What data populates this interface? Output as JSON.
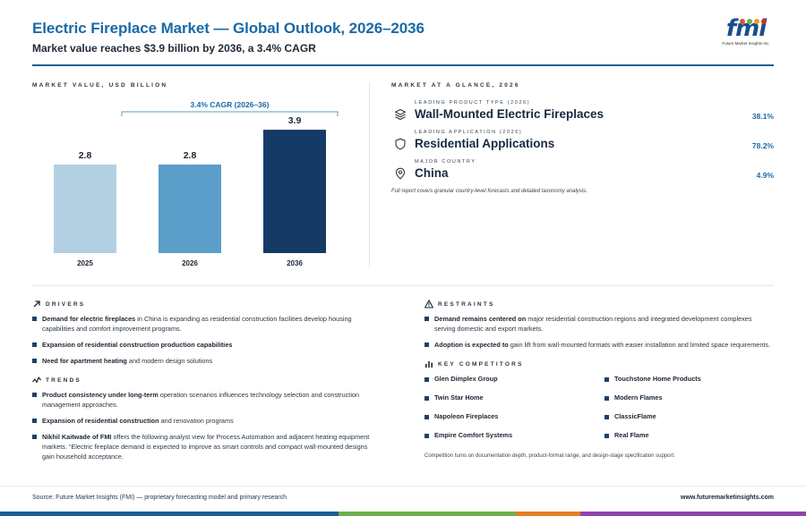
{
  "header": {
    "title": "Electric Fireplace Market — Global Outlook, 2026–2036",
    "subtitle": "Market value reaches $3.9 billion by 2036, a 3.4% CAGR"
  },
  "logo": {
    "text": "fmi",
    "tagline": "Future Market Insights Inc.",
    "dot_colors": [
      "#e84d3d",
      "#6ab04c",
      "#f39c12",
      "#c0392b"
    ]
  },
  "chart": {
    "section_label": "MARKET VALUE, USD BILLION",
    "cagr_label": "3.4% CAGR (2026–36)"
  },
  "chart_data": {
    "type": "bar",
    "categories": [
      "2025",
      "2026",
      "2036"
    ],
    "values": [
      2.8,
      2.8,
      3.9
    ],
    "value_labels": [
      "2.8",
      "2.8",
      "3.9"
    ],
    "colors": [
      "#b3d0e3",
      "#5b9ec9",
      "#163a66"
    ],
    "ylim": [
      0,
      4.1
    ],
    "annotation": "3.4% CAGR (2026–36)",
    "grid": false
  },
  "glance": {
    "section_label": "MARKET AT A GLANCE, 2026",
    "items": [
      {
        "label": "LEADING PRODUCT TYPE (2026)",
        "value": "Wall-Mounted Electric Fireplaces",
        "share": "38.1%",
        "icon": "layers-icon"
      },
      {
        "label": "LEADING APPLICATION (2026)",
        "value": "Residential Applications",
        "share": "78.2%",
        "icon": "shield-icon"
      },
      {
        "label": "MAJOR COUNTRY",
        "value": "China",
        "share": "4.9%",
        "icon": "location-pin-icon"
      }
    ],
    "note": "Full report covers granular country-level forecasts and detailed taxonomy analysis."
  },
  "drivers": {
    "label": "DRIVERS",
    "items": [
      {
        "bold": "Demand for electric fireplaces",
        "rest": " in China is expanding as residential construction facilities develop housing capabilities and comfort improvement programs."
      },
      {
        "bold": "Expansion of residential construction production capabilities",
        "rest": ""
      },
      {
        "bold": "Need for apartment heating",
        "rest": " and modern design solutions"
      }
    ]
  },
  "trends": {
    "label": "TRENDS",
    "items": [
      {
        "bold": "Product consistency under long-term",
        "rest": " operation scenarios influences technology selection and construction management approaches."
      },
      {
        "bold": "Expansion of residential construction",
        "rest": " and renovation programs"
      },
      {
        "bold": "Nikhil Kaitwade of FMI",
        "rest": " offers the following analyst view for Process Automation and adjacent heating equipment markets. “Electric fireplace demand is expected to improve as smart controls and compact wall-mounted designs gain household acceptance."
      }
    ]
  },
  "restraints": {
    "label": "RESTRAINTS",
    "items": [
      {
        "bold": "Demand remains centered on",
        "rest": " major residential construction regions and integrated development complexes serving domestic and export markets."
      },
      {
        "bold": "Adoption is expected to",
        "rest": " gain lift from wall-mounted formats with easier installation and limited space requirements."
      }
    ]
  },
  "competitors": {
    "label": "KEY COMPETITORS",
    "items": [
      "Glen Dimplex Group",
      "Touchstone Home Products",
      "Twin Star Home",
      "Modern Flames",
      "Napoleon Fireplaces",
      "ClassicFlame",
      "Empire Comfort Systems",
      "Real Flame"
    ],
    "note": "Competition turns on documentation depth, product-format range, and design-stage specification support."
  },
  "footer": {
    "source": "Source: Future Market Insights (FMI) — proprietary forecasting model and primary research",
    "url": "www.futuremarketinsights.com"
  },
  "bottom_bar_colors": [
    "#1b5e94",
    "#6ab04c",
    "#e67e22",
    "#8e44ad"
  ]
}
